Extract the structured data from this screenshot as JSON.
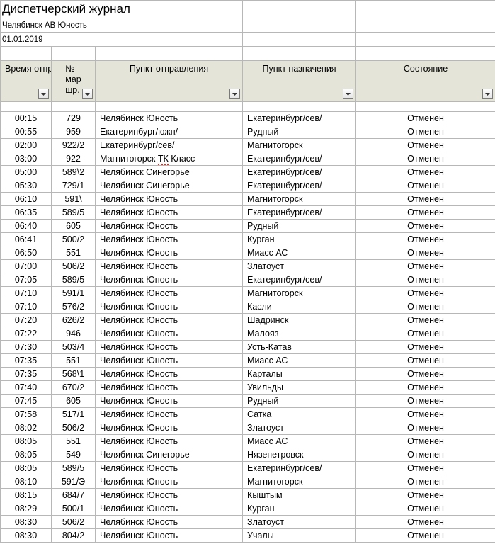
{
  "title": "Диспетчерский журнал",
  "meta": {
    "station": "Челябинск АВ Юность",
    "date": "01.01.2019"
  },
  "headers": {
    "time": "Время отпр.",
    "route_line1": "№",
    "route_line2": "мар",
    "route_line3": "шр.",
    "departure": "Пункт отправления",
    "destination": "Пункт назначения",
    "state": "Состояние"
  },
  "rows": [
    {
      "time": "00:15",
      "route": "729",
      "dep": "Челябинск Юность",
      "dest": "Екатеринбург/сев/",
      "state": "Отменен"
    },
    {
      "time": "00:55",
      "route": "959",
      "dep": "Екатеринбург/южн/",
      "dest": "Рудный",
      "state": "Отменен"
    },
    {
      "time": "02:00",
      "route": "922/2",
      "dep": "Екатеринбург/сев/",
      "dest": "Магнитогорск",
      "state": "Отменен"
    },
    {
      "time": "03:00",
      "route": "922",
      "dep": "Магнитогорск ТК Класс",
      "dep_spell": true,
      "dest": "Екатеринбург/сев/",
      "state": "Отменен"
    },
    {
      "time": "05:00",
      "route": "589\\2",
      "dep": "Челябинск Синегорье",
      "dest": "Екатеринбург/сев/",
      "state": "Отменен"
    },
    {
      "time": "05:30",
      "route": "729/1",
      "dep": "Челябинск Синегорье",
      "dest": "Екатеринбург/сев/",
      "state": "Отменен"
    },
    {
      "time": "06:10",
      "route": "591\\",
      "dep": "Челябинск Юность",
      "dest": "Магнитогорск",
      "state": "Отменен"
    },
    {
      "time": "06:35",
      "route": "589/5",
      "dep": "Челябинск Юность",
      "dest": "Екатеринбург/сев/",
      "state": "Отменен"
    },
    {
      "time": "06:40",
      "route": "605",
      "dep": "Челябинск Юность",
      "dest": "Рудный",
      "state": "Отменен"
    },
    {
      "time": "06:41",
      "route": "500/2",
      "dep": "Челябинск Юность",
      "dest": "Курган",
      "state": "Отменен"
    },
    {
      "time": "06:50",
      "route": "551",
      "dep": "Челябинск Юность",
      "dest": "Миасс АС",
      "state": "Отменен"
    },
    {
      "time": "07:00",
      "route": "506/2",
      "dep": "Челябинск Юность",
      "dest": "Златоуст",
      "state": "Отменен"
    },
    {
      "time": "07:05",
      "route": "589/5",
      "dep": "Челябинск Юность",
      "dest": "Екатеринбург/сев/",
      "state": "Отменен"
    },
    {
      "time": "07:10",
      "route": "591/1",
      "dep": "Челябинск Юность",
      "dest": "Магнитогорск",
      "state": "Отменен"
    },
    {
      "time": "07:10",
      "route": "576/2",
      "dep": "Челябинск Юность",
      "dest": "Касли",
      "state": "Отменен"
    },
    {
      "time": "07:20",
      "route": "626/2",
      "dep": "Челябинск Юность",
      "dest": "Шадринск",
      "state": "Отменен"
    },
    {
      "time": "07:22",
      "route": "946",
      "dep": "Челябинск Юность",
      "dest": "Малояз",
      "state": "Отменен"
    },
    {
      "time": "07:30",
      "route": "503/4",
      "dep": "Челябинск Юность",
      "dest": "Усть-Катав",
      "state": "Отменен"
    },
    {
      "time": "07:35",
      "route": "551",
      "dep": "Челябинск Юность",
      "dest": "Миасс АС",
      "state": "Отменен"
    },
    {
      "time": "07:35",
      "route": "568\\1",
      "dep": "Челябинск Юность",
      "dest": "Карталы",
      "state": "Отменен"
    },
    {
      "time": "07:40",
      "route": "670/2",
      "dep": "Челябинск Юность",
      "dest": "Увильды",
      "state": "Отменен"
    },
    {
      "time": "07:45",
      "route": "605",
      "dep": "Челябинск Юность",
      "dest": "Рудный",
      "state": "Отменен"
    },
    {
      "time": "07:58",
      "route": "517/1",
      "dep": "Челябинск Юность",
      "dest": "Сатка",
      "state": "Отменен"
    },
    {
      "time": "08:02",
      "route": "506/2",
      "dep": "Челябинск Юность",
      "dest": "Златоуст",
      "state": "Отменен"
    },
    {
      "time": "08:05",
      "route": "551",
      "dep": "Челябинск Юность",
      "dest": "Миасс АС",
      "state": "Отменен"
    },
    {
      "time": "08:05",
      "route": "549",
      "dep": "Челябинск Синегорье",
      "dest": "Нязепетровск",
      "state": "Отменен"
    },
    {
      "time": "08:05",
      "route": "589/5",
      "dep": "Челябинск Юность",
      "dest": "Екатеринбург/сев/",
      "state": "Отменен"
    },
    {
      "time": "08:10",
      "route": "591/Э",
      "dep": "Челябинск Юность",
      "dest": "Магнитогорск",
      "state": "Отменен"
    },
    {
      "time": "08:15",
      "route": "684/7",
      "dep": "Челябинск Юность",
      "dest": "Кыштым",
      "state": "Отменен"
    },
    {
      "time": "08:29",
      "route": "500/1",
      "dep": "Челябинск Юность",
      "dest": "Курган",
      "state": "Отменен"
    },
    {
      "time": "08:30",
      "route": "506/2",
      "dep": "Челябинск Юность",
      "dest": "Златоуст",
      "state": "Отменен"
    },
    {
      "time": "08:30",
      "route": "804/2",
      "dep": "Челябинск Юность",
      "dest": "Учалы",
      "state": "Отменен"
    }
  ]
}
